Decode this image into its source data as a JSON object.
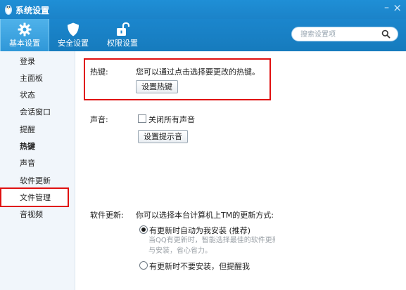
{
  "window": {
    "title": "系统设置"
  },
  "toolbar": {
    "tabs": [
      {
        "label": "基本设置",
        "icon": "gear-icon",
        "active": true
      },
      {
        "label": "安全设置",
        "icon": "shield-icon",
        "active": false
      },
      {
        "label": "权限设置",
        "icon": "unlock-icon",
        "active": false
      }
    ]
  },
  "search": {
    "placeholder": "搜索设置项"
  },
  "sidebar": {
    "items": [
      {
        "label": "登录"
      },
      {
        "label": "主面板"
      },
      {
        "label": "状态"
      },
      {
        "label": "会话窗口"
      },
      {
        "label": "提醒"
      },
      {
        "label": "热键",
        "selected": true
      },
      {
        "label": "声音"
      },
      {
        "label": "软件更新"
      },
      {
        "label": "文件管理"
      },
      {
        "label": "音视频"
      }
    ]
  },
  "hotkey": {
    "label": "热键:",
    "description": "您可以通过点击选择要更改的热键。",
    "button": "设置热键"
  },
  "sound": {
    "label": "声音:",
    "checkbox_label": "关闭所有声音",
    "button": "设置提示音"
  },
  "update": {
    "label": "软件更新:",
    "description": "你可以选择本台计算机上TM的更新方式:",
    "options": [
      {
        "label": "有更新时自动为我安装 (推荐)",
        "checked": true,
        "desc_line1": "当QQ有更新时，智能选择最佳的软件更新方案",
        "desc_line2": "与安装，省心省力。"
      },
      {
        "label": "有更新时不要安装，但提醒我",
        "checked": false
      }
    ]
  },
  "colors": {
    "accent": "#1b86cd",
    "highlight": "#e01010"
  }
}
